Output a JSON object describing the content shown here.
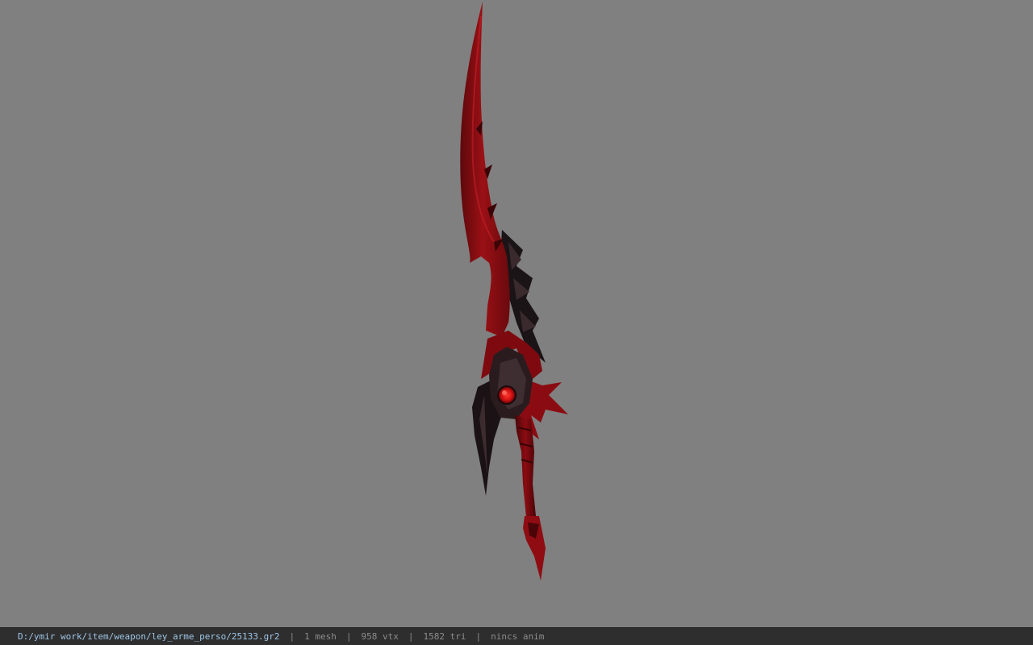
{
  "viewer": {
    "background_color": "#808080",
    "model": {
      "name": "sword-model",
      "blade_color": "#8a0d12",
      "dark_color": "#1a1214",
      "gem_color": "#e01818"
    }
  },
  "statusbar": {
    "file_path": "D:/ymir work/item/weapon/ley_arme_perso/25133.gr2",
    "separator": "|",
    "mesh_count": "1 mesh",
    "vertex_count": "958 vtx",
    "triangle_count": "1582 tri",
    "animation": "nincs anim"
  }
}
